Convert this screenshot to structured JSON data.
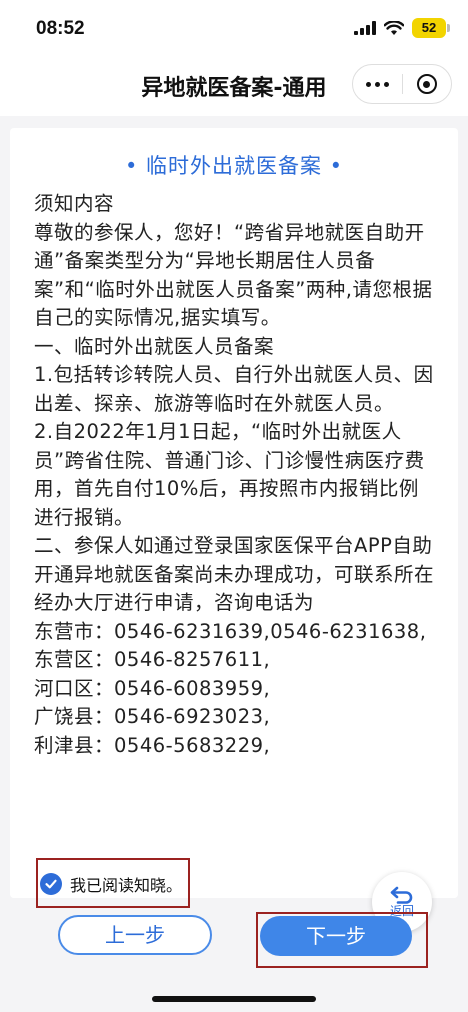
{
  "status_bar": {
    "time": "08:52",
    "battery": "52"
  },
  "nav": {
    "title": "异地就医备案-通用"
  },
  "notice": {
    "title": "• 临时外出就医备案 •",
    "paragraphs": [
      "须知内容",
      "尊敬的参保人，您好！“跨省异地就医自助开通”备案类型分为“异地长期居住人员备案”和“临时外出就医人员备案”两种,请您根据自己的实际情况,据实填写。",
      "一、临时外出就医人员备案",
      "1.包括转诊转院人员、自行外出就医人员、因出差、探亲、旅游等临时在外就医人员。",
      "2.自2022年1月1日起，“临时外出就医人员”跨省住院、普通门诊、门诊慢性病医疗费用，首先自付10%后，再按照市内报销比例进行报销。",
      "二、参保人如通过登录国家医保平台APP自助开通异地就医备案尚未办理成功，可联系所在经办大厅进行申请，咨询电话为",
      "东营市：0546-6231639,0546-6231638,",
      "东营区：0546-8257611,",
      "河口区：0546-6083959,",
      "广饶县：0546-6923023,",
      "利津县：0546-5683229,"
    ]
  },
  "agreement": {
    "label": "我已阅读知晓。",
    "checked": true
  },
  "back_fab": {
    "label": "返回"
  },
  "buttons": {
    "prev": "上一步",
    "next": "下一步"
  },
  "colors": {
    "accent": "#2d6cd8",
    "button_primary": "#3f86e8",
    "highlight_box": "#9b2220"
  }
}
